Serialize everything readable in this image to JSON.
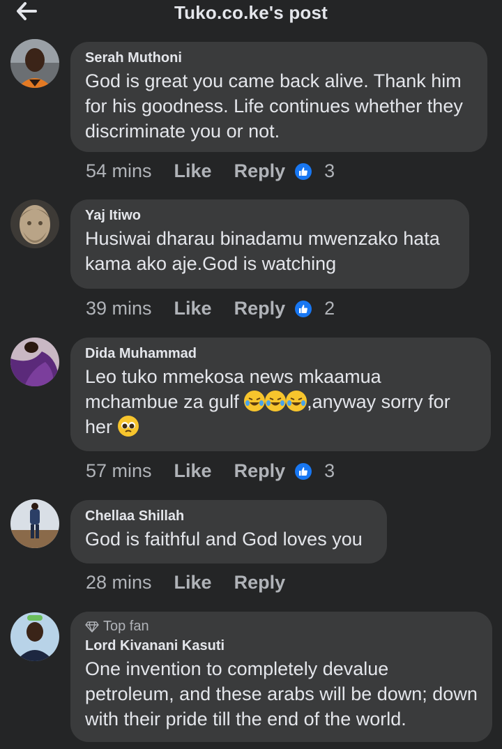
{
  "header": {
    "title": "Tuko.co.ke's post"
  },
  "comments": [
    {
      "author": "Serah Muthoni",
      "text": "God is great you came back alive. Thank him for his goodness. Life continues whether they discriminate you or not.",
      "time": "54 mins",
      "like": "Like",
      "reply": "Reply",
      "reactions": "3"
    },
    {
      "author": "Yaj Itiwo",
      "text": "Husiwai dharau binadamu mwenzako hata kama ako aje.God is watching",
      "time": "39 mins",
      "like": "Like",
      "reply": "Reply",
      "reactions": "2"
    },
    {
      "author": "Dida Muhammad",
      "text_part1": "Leo tuko mmekosa news mkaamua mchambue za gulf ",
      "text_part2": ",anyway sorry for her ",
      "emojis": [
        "rolling-on-floor-laughing",
        "rolling-on-floor-laughing",
        "rolling-on-floor-laughing",
        "pleading-face"
      ],
      "time": "57 mins",
      "like": "Like",
      "reply": "Reply",
      "reactions": "3"
    },
    {
      "author": "Chellaa Shillah",
      "text": "God is faithful and God loves you",
      "time": "28 mins",
      "like": "Like",
      "reply": "Reply"
    },
    {
      "badge": "Top fan",
      "author": "Lord Kivanani Kasuti",
      "text": "One invention to completely devalue petroleum, and these arabs will be down; down with their pride till the end of the world."
    }
  ],
  "colors": {
    "background": "#242526",
    "bubble": "#3a3b3c",
    "text": "#e4e6eb",
    "secondary_text": "#b0b3b8",
    "like_blue": "#1877f2"
  },
  "icons": [
    "back-arrow-icon",
    "thumbs-up-icon",
    "diamond-icon"
  ]
}
